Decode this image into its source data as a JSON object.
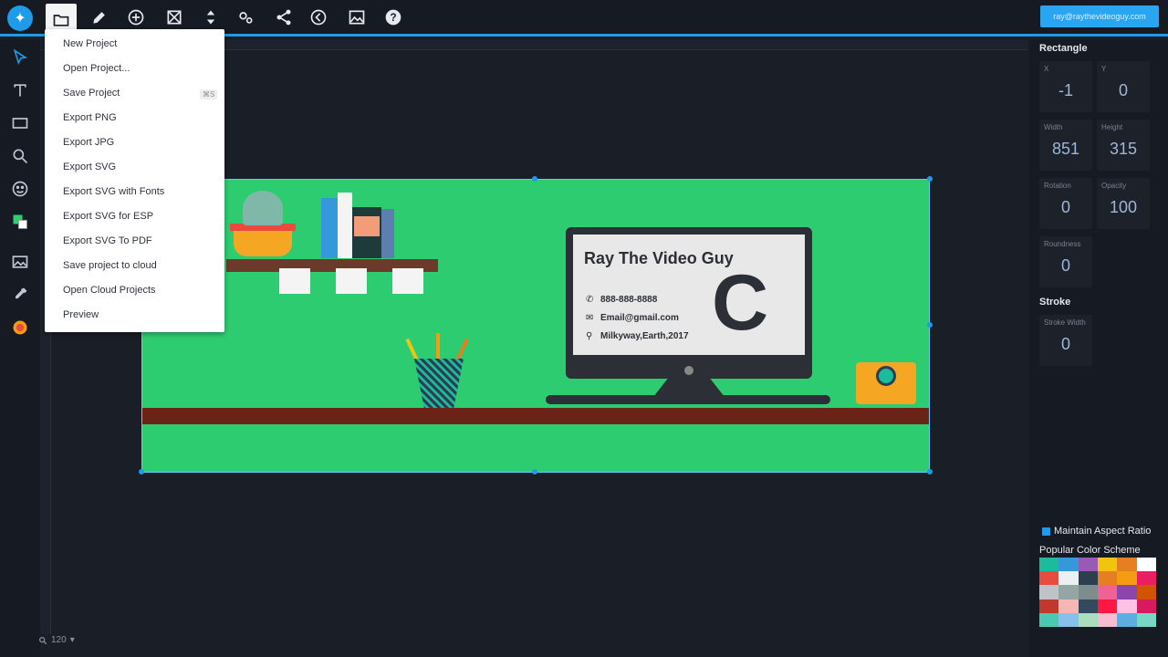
{
  "toolbar": {
    "buttons": [
      "logo-icon",
      "folder-icon",
      "pencil-icon",
      "plus-circle-icon",
      "resize-icon",
      "arrange-icon",
      "gears-icon",
      "share-icon",
      "back-icon",
      "image-icon",
      "help-icon"
    ],
    "user_email": "ray@raythevideoguy.com"
  },
  "file_menu": {
    "items": [
      "New Project",
      "Open Project...",
      "Save Project",
      "Export PNG",
      "Export JPG",
      "Export SVG",
      "Export SVG with Fonts",
      "Export SVG for ESP",
      "Export SVG To PDF",
      "Save project to cloud",
      "Open Cloud Projects",
      "Preview"
    ],
    "save_shortcut": "⌘S"
  },
  "canvas": {
    "card_name": "Ray The Video Guy",
    "phone": "888-888-8888",
    "email": "Email@gmail.com",
    "address": "Milkyway,Earth,2017",
    "logo_text": "C"
  },
  "properties": {
    "title": "Rectangle",
    "x_label": "X",
    "x_value": "-1",
    "y_label": "Y",
    "y_value": "0",
    "width_label": "Width",
    "width_value": "851",
    "height_label": "Height",
    "height_value": "315",
    "rotation_label": "Rotation",
    "rotation_value": "0",
    "opacity_label": "Opacity",
    "opacity_value": "100",
    "roundness_label": "Roundness",
    "roundness_value": "0",
    "stroke_title": "Stroke",
    "stroke_width_label": "Stroke Width",
    "stroke_width_value": "0",
    "maintain_aspect": "Maintain Aspect Ratio",
    "color_scheme_title": "Popular Color Scheme",
    "swatches": [
      "#1abc9c",
      "#3498db",
      "#9b59b6",
      "#f1c40f",
      "#e67e22",
      "#ffffff",
      "#e74c3c",
      "#ecf0f1",
      "#2c3e50",
      "#e67e22",
      "#f39c12",
      "#e91e63",
      "#bdc3c7",
      "#95a5a6",
      "#7f8c8d",
      "#f06292",
      "#8e44ad",
      "#d35400",
      "#c0392b",
      "#f5b7b1",
      "#34495e",
      "#ff1744",
      "#ffc1e3",
      "#d81b60",
      "#48c9b0",
      "#85c1e9",
      "#a9dfbf",
      "#f8bbd0",
      "#5dade2",
      "#76d7c4"
    ]
  },
  "status": {
    "zoom": "120"
  }
}
